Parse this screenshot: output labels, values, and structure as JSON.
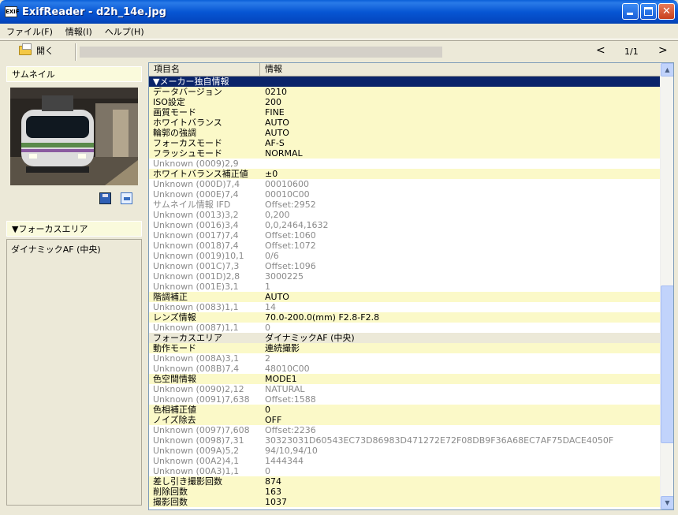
{
  "window": {
    "title": "ExifReader - d2h_14e.jpg",
    "icon_text": "EXIF"
  },
  "menu": [
    {
      "label": "ファイル(F)"
    },
    {
      "label": "情報(I)"
    },
    {
      "label": "ヘルプ(H)"
    }
  ],
  "toolbar": {
    "open_label": "開く",
    "prev": "<",
    "page": "1/1",
    "next": ">"
  },
  "left": {
    "thumbnail_header": "サムネイル",
    "focus_header": "▼フォーカスエリア",
    "focus_value": "ダイナミックAF (中央)"
  },
  "table": {
    "col1": "項目名",
    "col2": "情報",
    "rows": [
      {
        "k": "▼メーカー独自情報",
        "v": "",
        "t": "section"
      },
      {
        "k": "データバージョン",
        "v": "0210",
        "t": "known"
      },
      {
        "k": "ISO設定",
        "v": "200",
        "t": "known"
      },
      {
        "k": "画質モード",
        "v": "FINE",
        "t": "known"
      },
      {
        "k": "ホワイトバランス",
        "v": "AUTO",
        "t": "known"
      },
      {
        "k": "輪郭の強調",
        "v": "AUTO",
        "t": "known"
      },
      {
        "k": "フォーカスモード",
        "v": "AF-S",
        "t": "known"
      },
      {
        "k": "フラッシュモード",
        "v": "NORMAL",
        "t": "known"
      },
      {
        "k": "Unknown (0009)2,9",
        "v": "",
        "t": "unknown"
      },
      {
        "k": "ホワイトバランス補正値",
        "v": "±0",
        "t": "known"
      },
      {
        "k": "Unknown (000D)7,4",
        "v": "00010600",
        "t": "unknown"
      },
      {
        "k": "Unknown (000E)7,4",
        "v": "00010C00",
        "t": "unknown"
      },
      {
        "k": "サムネイル情報 IFD",
        "v": "Offset:2952",
        "t": "unknown"
      },
      {
        "k": "Unknown (0013)3,2",
        "v": "0,200",
        "t": "unknown"
      },
      {
        "k": "Unknown (0016)3,4",
        "v": "0,0,2464,1632",
        "t": "unknown"
      },
      {
        "k": "Unknown (0017)7,4",
        "v": "Offset:1060",
        "t": "unknown"
      },
      {
        "k": "Unknown (0018)7,4",
        "v": "Offset:1072",
        "t": "unknown"
      },
      {
        "k": "Unknown (0019)10,1",
        "v": "0/6",
        "t": "unknown"
      },
      {
        "k": "Unknown (001C)7,3",
        "v": "Offset:1096",
        "t": "unknown"
      },
      {
        "k": "Unknown (001D)2,8",
        "v": "3000225",
        "t": "unknown"
      },
      {
        "k": "Unknown (001E)3,1",
        "v": "1",
        "t": "unknown"
      },
      {
        "k": "階調補正",
        "v": "AUTO",
        "t": "known"
      },
      {
        "k": "Unknown (0083)1,1",
        "v": "14",
        "t": "unknown"
      },
      {
        "k": "レンズ情報",
        "v": "70.0-200.0(mm) F2.8-F2.8",
        "t": "known"
      },
      {
        "k": "Unknown (0087)1,1",
        "v": "0",
        "t": "unknown"
      },
      {
        "k": "フォーカスエリア",
        "v": "ダイナミックAF (中央)",
        "t": "selected"
      },
      {
        "k": "動作モード",
        "v": "連続撮影",
        "t": "known"
      },
      {
        "k": "Unknown (008A)3,1",
        "v": "2",
        "t": "unknown"
      },
      {
        "k": "Unknown (008B)7,4",
        "v": "48010C00",
        "t": "unknown"
      },
      {
        "k": "色空間情報",
        "v": "MODE1",
        "t": "known"
      },
      {
        "k": "Unknown (0090)2,12",
        "v": "NATURAL",
        "t": "unknown"
      },
      {
        "k": "Unknown (0091)7,638",
        "v": "Offset:1588",
        "t": "unknown"
      },
      {
        "k": "色相補正値",
        "v": "0",
        "t": "known"
      },
      {
        "k": "ノイズ除去",
        "v": "OFF",
        "t": "known"
      },
      {
        "k": "Unknown (0097)7,608",
        "v": "Offset:2236",
        "t": "unknown"
      },
      {
        "k": "Unknown (0098)7,31",
        "v": "30323031D60543EC73D86983D471272E72F08DB9F36A68EC7AF75DACE4050F",
        "t": "unknown"
      },
      {
        "k": "Unknown (009A)5,2",
        "v": "94/10,94/10",
        "t": "unknown"
      },
      {
        "k": "Unknown (00A2)4,1",
        "v": "1444344",
        "t": "unknown"
      },
      {
        "k": "Unknown (00A3)1,1",
        "v": "0",
        "t": "unknown"
      },
      {
        "k": "差し引き撮影回数",
        "v": "874",
        "t": "known"
      },
      {
        "k": "削除回数",
        "v": "163",
        "t": "known"
      },
      {
        "k": "撮影回数",
        "v": "1037",
        "t": "known"
      }
    ]
  },
  "colors": {
    "known_row": "#fbf9c8",
    "unknown_text": "#8a8a8a",
    "section_row": "#0a246a",
    "titlebar": "#0756d4"
  }
}
